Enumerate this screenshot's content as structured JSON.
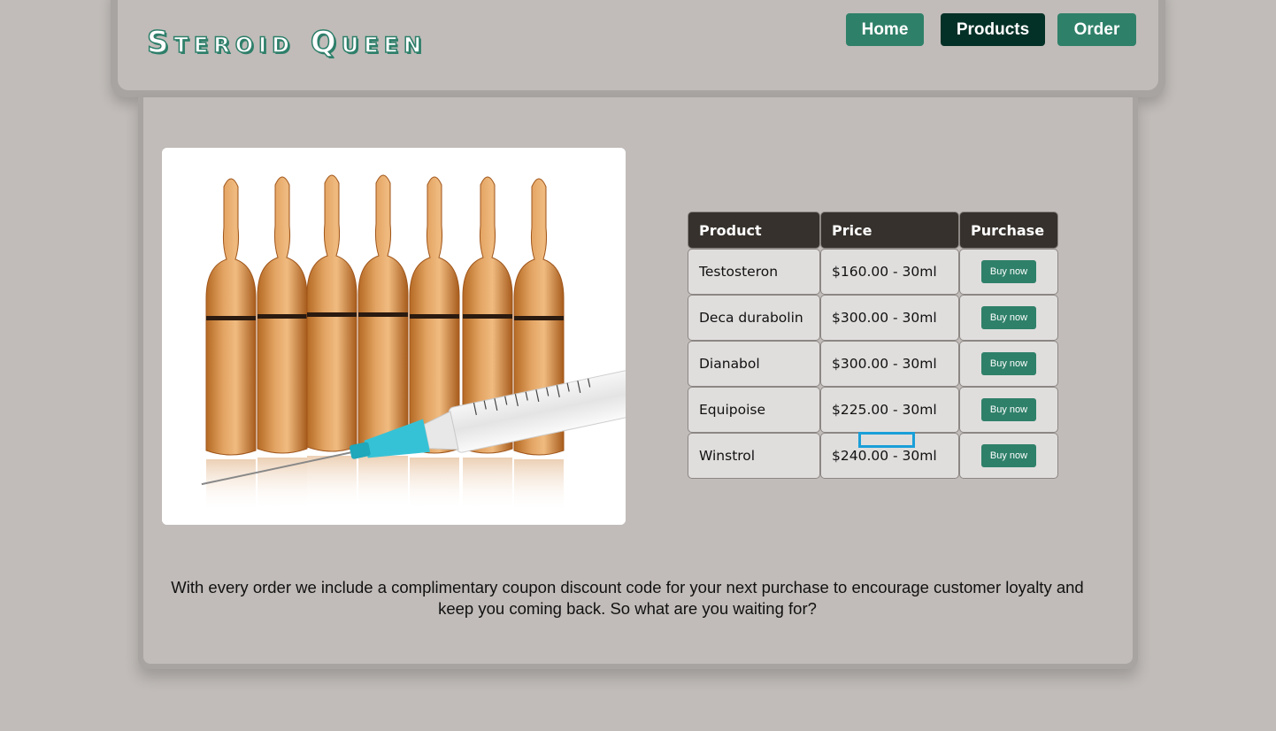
{
  "header": {
    "logo_text": "Steroid Queen",
    "nav": [
      {
        "label": "Home"
      },
      {
        "label": "Products"
      },
      {
        "label": "Order"
      }
    ]
  },
  "table": {
    "headers": [
      "Product",
      "Price",
      "Purchase"
    ],
    "rows": [
      {
        "product": "Testosteron",
        "price": "$160.00 - 30ml",
        "action": "Buy now"
      },
      {
        "product": "Deca durabolin",
        "price": "$300.00 - 30ml",
        "action": "Buy now"
      },
      {
        "product": "Dianabol",
        "price": "$300.00 - 30ml",
        "action": "Buy now"
      },
      {
        "product": "Equipoise",
        "price": "$225.00 - 30ml",
        "action": "Buy now"
      },
      {
        "product": "Winstrol",
        "price": "$240.00 - 30ml",
        "action": "Buy now"
      }
    ]
  },
  "promo_text": "With every order we include a complimentary coupon discount code for your next purchase to encourage customer loyalty and keep you coming back. So what are you waiting for?",
  "colors": {
    "background": "#c1bcb9",
    "accent": "#2f8069",
    "nav_active": "#043127",
    "table_header": "#36312c",
    "focus_ring": "#1a9fd8"
  }
}
